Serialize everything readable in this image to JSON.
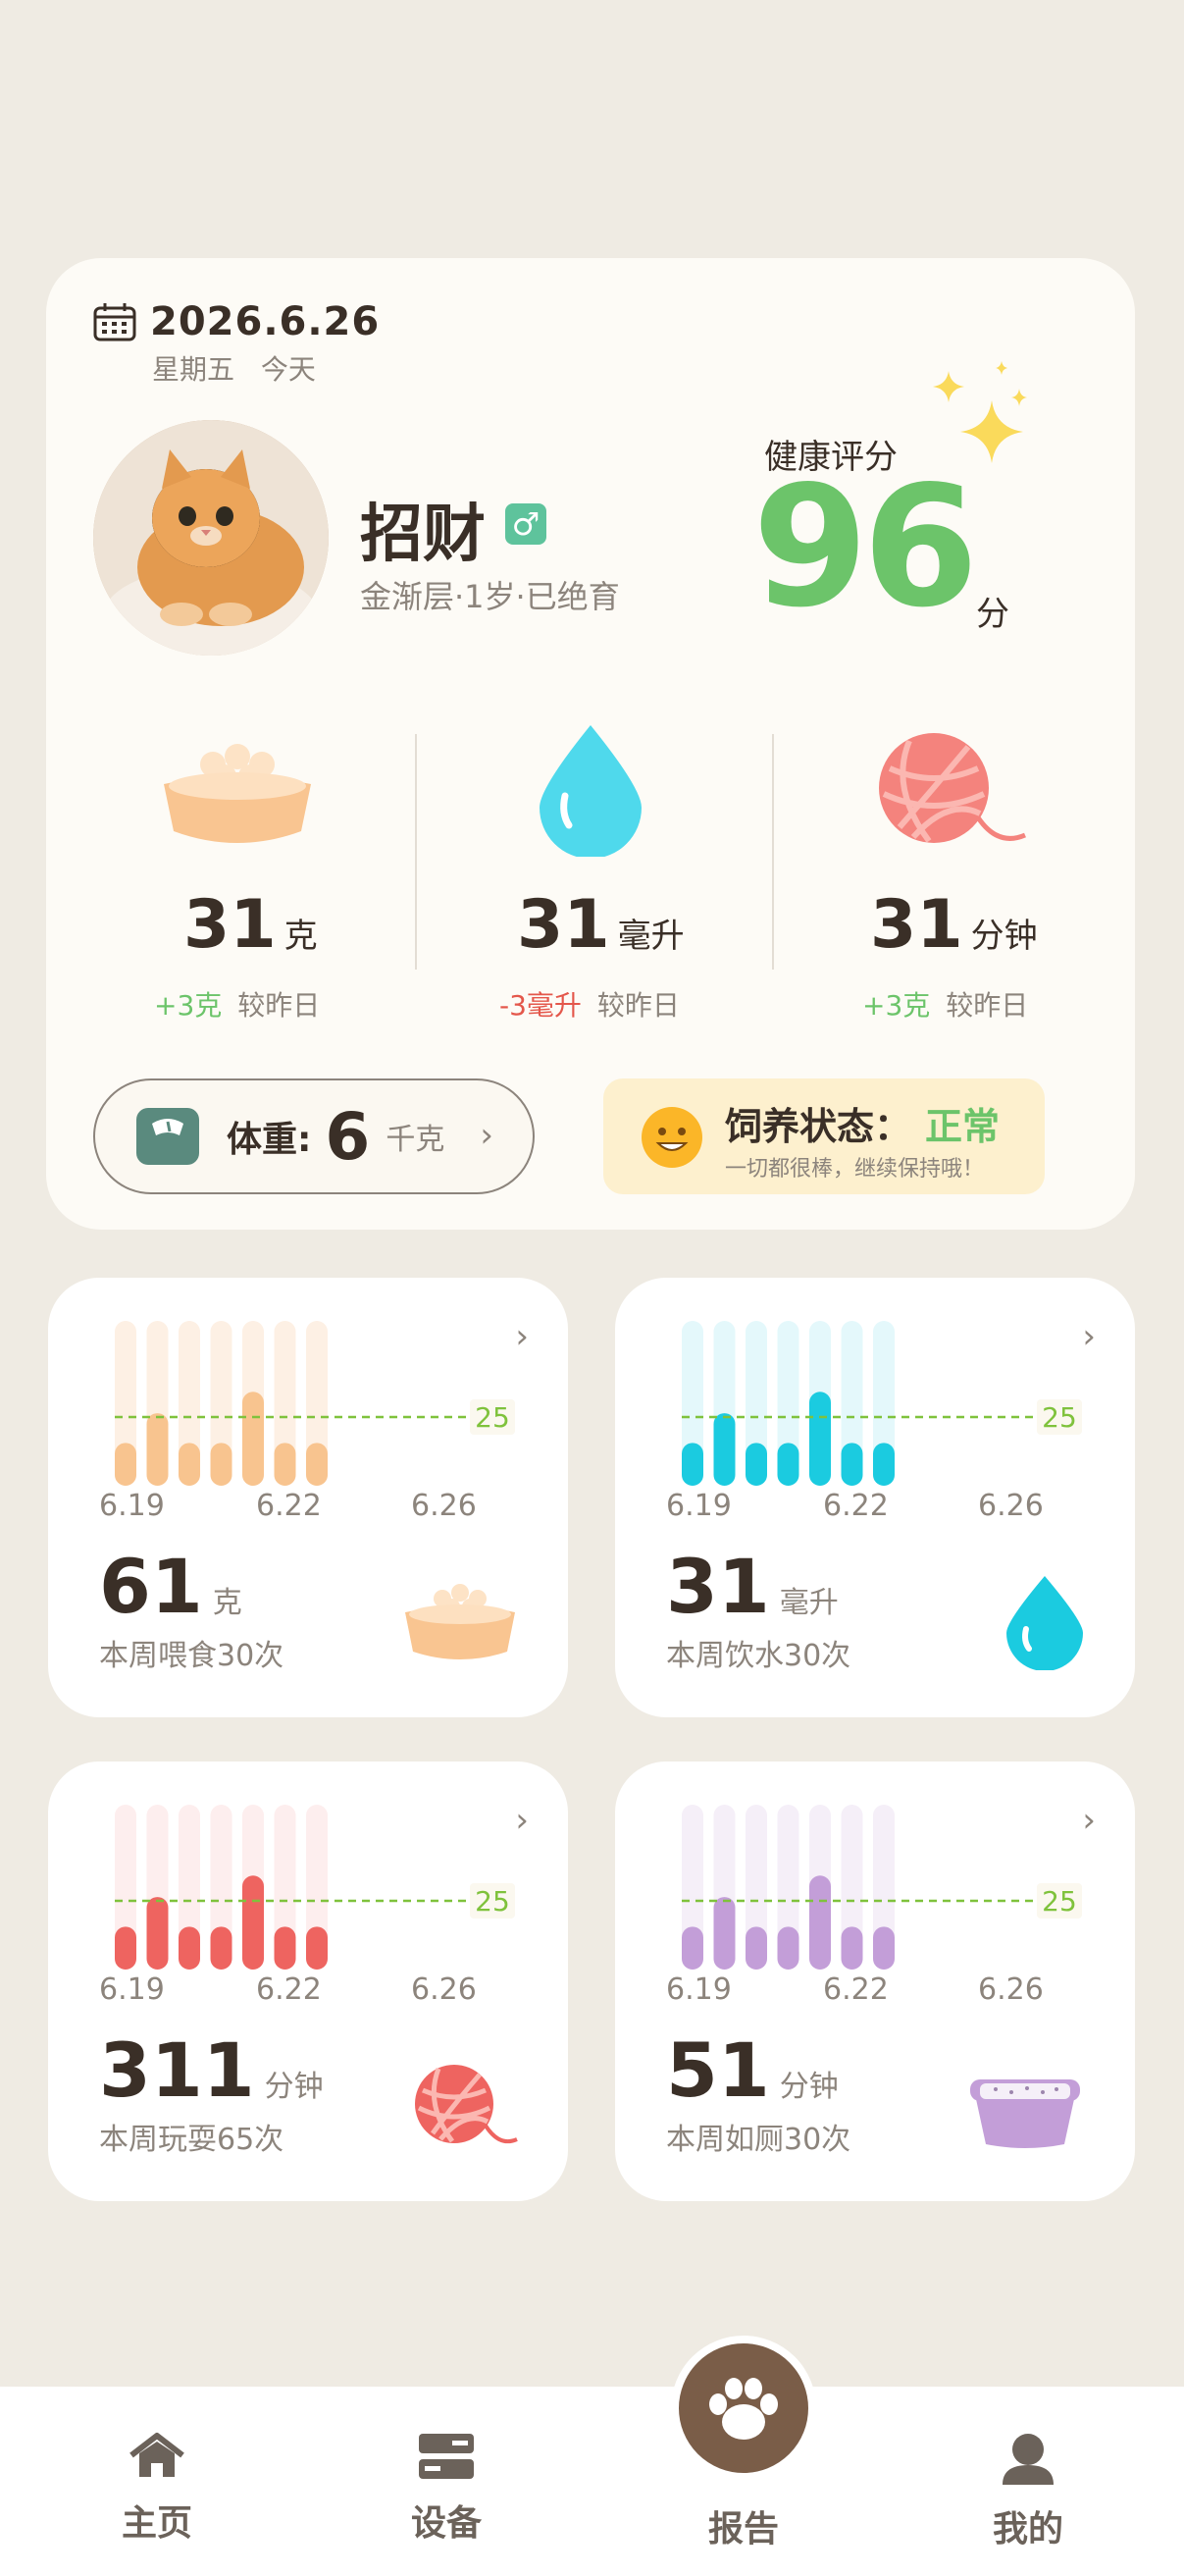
{
  "header": {
    "date": "2026.6.26",
    "weekday": "星期五",
    "day_tag": "今天"
  },
  "pet": {
    "name": "招财",
    "gender_symbol": "♂",
    "info": "金渐层·1岁·已绝育"
  },
  "health": {
    "label": "健康评分",
    "score": "96",
    "unit": "分"
  },
  "metrics": [
    {
      "value": "31",
      "unit": "克",
      "change": "+3克",
      "compare": "较昨日",
      "icon": "food-bowl-icon"
    },
    {
      "value": "31",
      "unit": "毫升",
      "change": "-3毫升",
      "compare": "较昨日",
      "icon": "water-drop-icon"
    },
    {
      "value": "31",
      "unit": "分钟",
      "change": "+3克",
      "compare": "较昨日",
      "icon": "yarn-ball-icon"
    }
  ],
  "weight": {
    "label": "体重:",
    "value": "6",
    "unit": "千克",
    "arrow": "›"
  },
  "status": {
    "title": "饲养状态：",
    "value": "正常",
    "subtitle": "一切都很棒，继续保持哦！"
  },
  "cards": [
    {
      "value": "61",
      "unit": "克",
      "subtitle": "本周喂食30次",
      "ticks": [
        "6.19",
        "6.22",
        "6.26"
      ],
      "target": "25",
      "color": "#f8c48f",
      "track": "#fdf0e4",
      "values": [
        0.26,
        0.44,
        0.26,
        0.26,
        0.57,
        0.26,
        0.26
      ]
    },
    {
      "value": "31",
      "unit": "毫升",
      "subtitle": "本周饮水30次",
      "ticks": [
        "6.19",
        "6.22",
        "6.26"
      ],
      "target": "25",
      "color": "#1bcbe0",
      "track": "#e4f8fb",
      "values": [
        0.26,
        0.44,
        0.26,
        0.26,
        0.57,
        0.26,
        0.26
      ]
    },
    {
      "value": "311",
      "unit": "分钟",
      "subtitle": "本周玩耍65次",
      "ticks": [
        "6.19",
        "6.22",
        "6.26"
      ],
      "target": "25",
      "color": "#ee6460",
      "track": "#fdeeee",
      "values": [
        0.26,
        0.44,
        0.26,
        0.26,
        0.57,
        0.26,
        0.26
      ]
    },
    {
      "value": "51",
      "unit": "分钟",
      "subtitle": "本周如厕30次",
      "ticks": [
        "6.19",
        "6.22",
        "6.26"
      ],
      "target": "25",
      "color": "#c39ed8",
      "track": "#f5eff8",
      "values": [
        0.26,
        0.44,
        0.26,
        0.26,
        0.57,
        0.26,
        0.26
      ]
    }
  ],
  "nav": {
    "home": "主页",
    "device": "设备",
    "report": "报告",
    "mine": "我的"
  },
  "colors": {
    "background": "#efebe3",
    "accent_green": "#6cc46a",
    "accent_red": "#e4574b",
    "brand_brown": "#7a5d48"
  }
}
